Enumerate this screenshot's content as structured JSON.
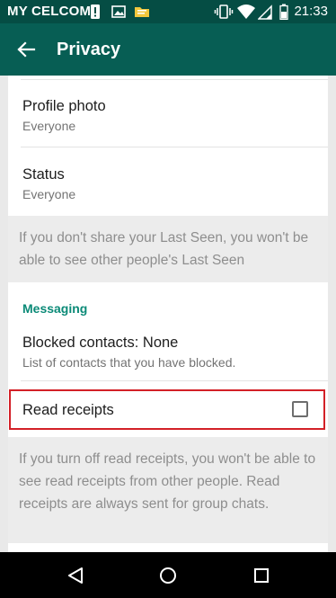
{
  "status_bar": {
    "carrier": "MY CELCOM",
    "time": "21:33",
    "icons": [
      "alert-icon",
      "image-icon",
      "folder-icon",
      "vibrate-icon",
      "wifi-icon",
      "signal-icon",
      "battery-icon"
    ]
  },
  "app_bar": {
    "title": "Privacy",
    "back_icon": "arrow-back-icon"
  },
  "settings": {
    "profile_photo": {
      "title": "Profile photo",
      "value": "Everyone"
    },
    "status": {
      "title": "Status",
      "value": "Everyone"
    },
    "last_seen_info": "If you don't share your Last Seen, you won't be able to see other people's Last Seen",
    "messaging_header": "Messaging",
    "blocked_contacts": {
      "title": "Blocked contacts: None",
      "subtitle": "List of contacts that you have blocked."
    },
    "read_receipts": {
      "title": "Read receipts",
      "checked": false
    },
    "read_receipts_info": "If you turn off read receipts, you won't be able to see read receipts from other people. Read receipts are always sent for group chats."
  },
  "nav_bar": {
    "icons": [
      "back-triangle-icon",
      "home-circle-icon",
      "recents-square-icon"
    ]
  },
  "colors": {
    "status_bar": "#054d44",
    "app_bar": "#075e54",
    "accent": "#0b8a77",
    "highlight_border": "#d32027"
  }
}
